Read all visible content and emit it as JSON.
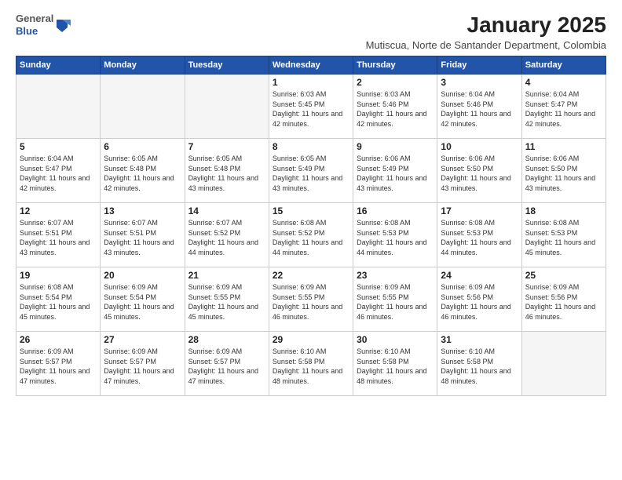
{
  "logo": {
    "line1": "General",
    "line2": "Blue"
  },
  "title": "January 2025",
  "location": "Mutiscua, Norte de Santander Department, Colombia",
  "headers": [
    "Sunday",
    "Monday",
    "Tuesday",
    "Wednesday",
    "Thursday",
    "Friday",
    "Saturday"
  ],
  "weeks": [
    [
      {
        "day": "",
        "info": ""
      },
      {
        "day": "",
        "info": ""
      },
      {
        "day": "",
        "info": ""
      },
      {
        "day": "1",
        "info": "Sunrise: 6:03 AM\nSunset: 5:45 PM\nDaylight: 11 hours\nand 42 minutes."
      },
      {
        "day": "2",
        "info": "Sunrise: 6:03 AM\nSunset: 5:46 PM\nDaylight: 11 hours\nand 42 minutes."
      },
      {
        "day": "3",
        "info": "Sunrise: 6:04 AM\nSunset: 5:46 PM\nDaylight: 11 hours\nand 42 minutes."
      },
      {
        "day": "4",
        "info": "Sunrise: 6:04 AM\nSunset: 5:47 PM\nDaylight: 11 hours\nand 42 minutes."
      }
    ],
    [
      {
        "day": "5",
        "info": "Sunrise: 6:04 AM\nSunset: 5:47 PM\nDaylight: 11 hours\nand 42 minutes."
      },
      {
        "day": "6",
        "info": "Sunrise: 6:05 AM\nSunset: 5:48 PM\nDaylight: 11 hours\nand 42 minutes."
      },
      {
        "day": "7",
        "info": "Sunrise: 6:05 AM\nSunset: 5:48 PM\nDaylight: 11 hours\nand 43 minutes."
      },
      {
        "day": "8",
        "info": "Sunrise: 6:05 AM\nSunset: 5:49 PM\nDaylight: 11 hours\nand 43 minutes."
      },
      {
        "day": "9",
        "info": "Sunrise: 6:06 AM\nSunset: 5:49 PM\nDaylight: 11 hours\nand 43 minutes."
      },
      {
        "day": "10",
        "info": "Sunrise: 6:06 AM\nSunset: 5:50 PM\nDaylight: 11 hours\nand 43 minutes."
      },
      {
        "day": "11",
        "info": "Sunrise: 6:06 AM\nSunset: 5:50 PM\nDaylight: 11 hours\nand 43 minutes."
      }
    ],
    [
      {
        "day": "12",
        "info": "Sunrise: 6:07 AM\nSunset: 5:51 PM\nDaylight: 11 hours\nand 43 minutes."
      },
      {
        "day": "13",
        "info": "Sunrise: 6:07 AM\nSunset: 5:51 PM\nDaylight: 11 hours\nand 43 minutes."
      },
      {
        "day": "14",
        "info": "Sunrise: 6:07 AM\nSunset: 5:52 PM\nDaylight: 11 hours\nand 44 minutes."
      },
      {
        "day": "15",
        "info": "Sunrise: 6:08 AM\nSunset: 5:52 PM\nDaylight: 11 hours\nand 44 minutes."
      },
      {
        "day": "16",
        "info": "Sunrise: 6:08 AM\nSunset: 5:53 PM\nDaylight: 11 hours\nand 44 minutes."
      },
      {
        "day": "17",
        "info": "Sunrise: 6:08 AM\nSunset: 5:53 PM\nDaylight: 11 hours\nand 44 minutes."
      },
      {
        "day": "18",
        "info": "Sunrise: 6:08 AM\nSunset: 5:53 PM\nDaylight: 11 hours\nand 45 minutes."
      }
    ],
    [
      {
        "day": "19",
        "info": "Sunrise: 6:08 AM\nSunset: 5:54 PM\nDaylight: 11 hours\nand 45 minutes."
      },
      {
        "day": "20",
        "info": "Sunrise: 6:09 AM\nSunset: 5:54 PM\nDaylight: 11 hours\nand 45 minutes."
      },
      {
        "day": "21",
        "info": "Sunrise: 6:09 AM\nSunset: 5:55 PM\nDaylight: 11 hours\nand 45 minutes."
      },
      {
        "day": "22",
        "info": "Sunrise: 6:09 AM\nSunset: 5:55 PM\nDaylight: 11 hours\nand 46 minutes."
      },
      {
        "day": "23",
        "info": "Sunrise: 6:09 AM\nSunset: 5:55 PM\nDaylight: 11 hours\nand 46 minutes."
      },
      {
        "day": "24",
        "info": "Sunrise: 6:09 AM\nSunset: 5:56 PM\nDaylight: 11 hours\nand 46 minutes."
      },
      {
        "day": "25",
        "info": "Sunrise: 6:09 AM\nSunset: 5:56 PM\nDaylight: 11 hours\nand 46 minutes."
      }
    ],
    [
      {
        "day": "26",
        "info": "Sunrise: 6:09 AM\nSunset: 5:57 PM\nDaylight: 11 hours\nand 47 minutes."
      },
      {
        "day": "27",
        "info": "Sunrise: 6:09 AM\nSunset: 5:57 PM\nDaylight: 11 hours\nand 47 minutes."
      },
      {
        "day": "28",
        "info": "Sunrise: 6:09 AM\nSunset: 5:57 PM\nDaylight: 11 hours\nand 47 minutes."
      },
      {
        "day": "29",
        "info": "Sunrise: 6:10 AM\nSunset: 5:58 PM\nDaylight: 11 hours\nand 48 minutes."
      },
      {
        "day": "30",
        "info": "Sunrise: 6:10 AM\nSunset: 5:58 PM\nDaylight: 11 hours\nand 48 minutes."
      },
      {
        "day": "31",
        "info": "Sunrise: 6:10 AM\nSunset: 5:58 PM\nDaylight: 11 hours\nand 48 minutes."
      },
      {
        "day": "",
        "info": ""
      }
    ]
  ]
}
